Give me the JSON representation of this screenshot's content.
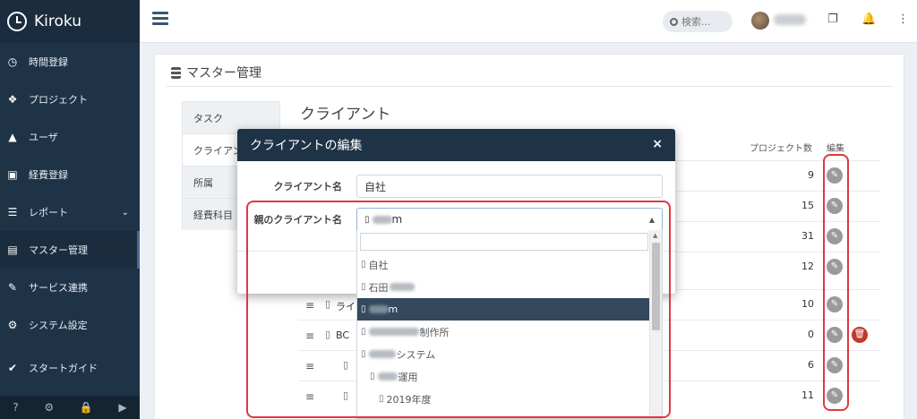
{
  "app": {
    "brand": "Kiroku"
  },
  "sidebar": {
    "items": [
      {
        "label": "時間登録",
        "icon": "clock-icon",
        "glyph": "◷"
      },
      {
        "label": "プロジェクト",
        "icon": "cubes-icon",
        "glyph": "❖"
      },
      {
        "label": "ユーザ",
        "icon": "user-icon",
        "glyph": "▲"
      },
      {
        "label": "経費登録",
        "icon": "train-icon",
        "glyph": "▣"
      },
      {
        "label": "レポート",
        "icon": "list-icon",
        "glyph": "☰",
        "chevron": "⌄"
      },
      {
        "label": "マスター管理",
        "icon": "database-icon",
        "glyph": "▤"
      },
      {
        "label": "サービス連携",
        "icon": "plug-icon",
        "glyph": "✎"
      },
      {
        "label": "システム設定",
        "icon": "gear-icon",
        "glyph": "⚙"
      },
      {
        "label": "スタートガイド",
        "icon": "check-icon",
        "glyph": "✔"
      }
    ],
    "footer_icons": [
      {
        "name": "help-icon",
        "glyph": "?"
      },
      {
        "name": "settings-icon",
        "glyph": "⚙"
      },
      {
        "name": "lock-icon",
        "glyph": "🔒"
      },
      {
        "name": "play-icon",
        "glyph": "▶"
      }
    ]
  },
  "topbar": {
    "search_label": "検索...",
    "icons": [
      {
        "name": "notes-icon",
        "glyph": "❐"
      },
      {
        "name": "bell-icon",
        "glyph": "🔔"
      },
      {
        "name": "more-vertical-icon",
        "glyph": "⋮"
      }
    ]
  },
  "page": {
    "title": "マスター管理",
    "tabs": [
      "タスク",
      "クライアント",
      "所属",
      "経費科目"
    ],
    "section_title": "クライアント",
    "table": {
      "col_count": "プロジェクト数",
      "col_edit": "編集",
      "rows": [
        {
          "name": "",
          "count": "9"
        },
        {
          "name": "",
          "count": "15"
        },
        {
          "name": "",
          "count": "31"
        },
        {
          "name": "",
          "count": "12"
        },
        {
          "name": "ライ",
          "count": "10"
        },
        {
          "name": "BC",
          "count": "0",
          "deletable": true
        },
        {
          "name": "",
          "count": "6"
        },
        {
          "name": "",
          "count": "11"
        }
      ]
    }
  },
  "modal": {
    "title": "クライアントの編集",
    "close": "×",
    "client_name_label": "クライアント名",
    "client_name_value": "自社",
    "parent_label": "親のクライアント名",
    "parent_value_suffix": "m",
    "caret": "▲"
  },
  "dropdown": {
    "items": [
      {
        "text": "自社",
        "indent": 0
      },
      {
        "text": "石田",
        "indent": 0,
        "blur": true
      },
      {
        "text": "m",
        "indent": 0,
        "blur": true,
        "selected": true
      },
      {
        "text": "制作所",
        "indent": 0,
        "blur": true
      },
      {
        "text": "システム",
        "indent": 0,
        "blur": true
      },
      {
        "text": "運用",
        "indent": 1,
        "blur": true
      },
      {
        "text": "2019年度",
        "indent": 2
      }
    ]
  },
  "colors": {
    "sidebar_bg": "#1f3347",
    "modal_header_bg": "#1f3347",
    "selected_option_bg": "#34495e",
    "delete_red": "#c0392b",
    "highlight_red": "#e0383e"
  }
}
